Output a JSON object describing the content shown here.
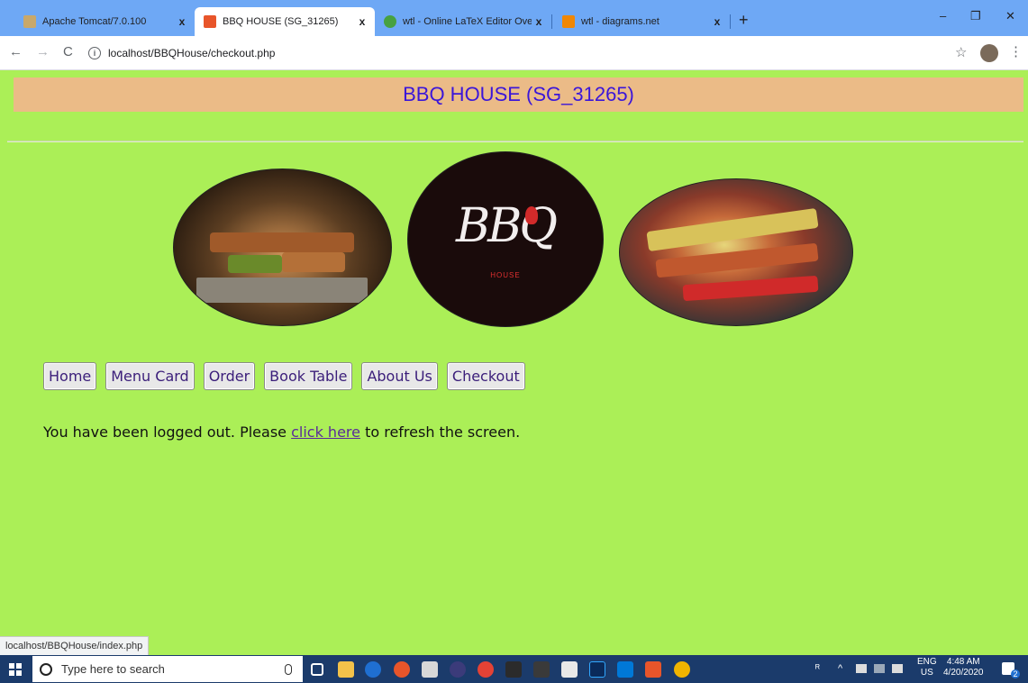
{
  "browser": {
    "tabs": [
      {
        "title": "Apache Tomcat/7.0.100",
        "close": "x",
        "favicon_color": "#c9a86a"
      },
      {
        "title": "BBQ HOUSE (SG_31265)",
        "close": "x",
        "favicon_color": "#e8552a"
      },
      {
        "title": "wtl - Online LaTeX Editor Overleaf",
        "close": "x",
        "favicon_color": "#47a141"
      },
      {
        "title": "wtl - diagrams.net",
        "close": "x",
        "favicon_color": "#f08705"
      }
    ],
    "new_tab": "+",
    "window_controls": {
      "minimize": "–",
      "restore": "❐",
      "close": "✕"
    },
    "nav": {
      "back": "←",
      "forward": "→",
      "reload": "C"
    },
    "address": "localhost/BBQHouse/checkout.php",
    "info_icon": "i",
    "bookmark_star": "☆",
    "menu": "⋮"
  },
  "page": {
    "header_title": "BBQ HOUSE (SG_31265)",
    "logo": {
      "text": "BBQ",
      "subtext": "HOUSE"
    },
    "nav": [
      "Home",
      "Menu Card",
      "Order",
      "Book Table",
      "About Us",
      "Checkout"
    ],
    "message": {
      "before": "You have been logged out. Please ",
      "link": "click here",
      "after": " to refresh the screen."
    },
    "status_url": "localhost/BBQHouse/index.php"
  },
  "taskbar": {
    "search_placeholder": "Type here to search",
    "lang": "ENG",
    "region": "US",
    "time": "4:48 AM",
    "date": "4/20/2020",
    "notification_count": "2"
  },
  "colors": {
    "page_bg": "#abef57",
    "header_bg": "#ebbb87",
    "header_text": "#3b16d9",
    "tabstrip": "#6ea8f5",
    "taskbar": "#1b3b6b"
  }
}
